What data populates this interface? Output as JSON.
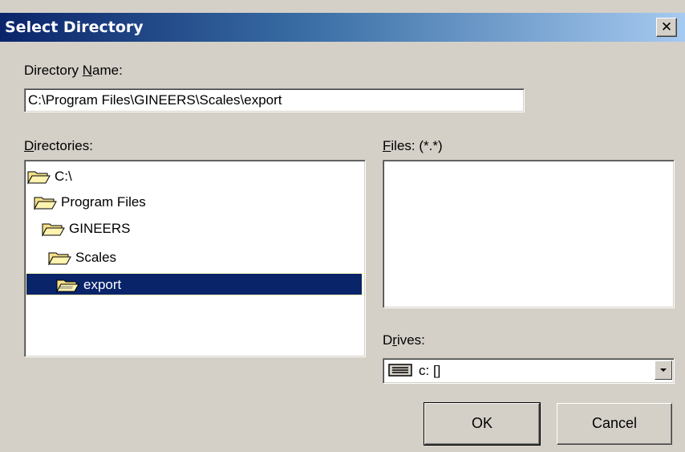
{
  "window": {
    "title": "Select Directory",
    "close_glyph": "✕"
  },
  "dirname": {
    "label_pre": "Directory ",
    "label_accel": "N",
    "label_post": "ame:",
    "value": "C:\\Program Files\\GINEERS\\Scales\\export"
  },
  "directories": {
    "label_accel": "D",
    "label_post": "irectories:",
    "items": [
      {
        "label": "C:\\",
        "icon": "open-folder-icon"
      },
      {
        "label": "Program Files",
        "icon": "open-folder-icon"
      },
      {
        "label": "GINEERS",
        "icon": "open-folder-icon"
      },
      {
        "label": "Scales",
        "icon": "open-folder-icon"
      },
      {
        "label": "export",
        "icon": "open-folder-selected-icon",
        "selected": true
      }
    ]
  },
  "files": {
    "label_accel": "F",
    "label_post": "iles: (*.*)"
  },
  "drives": {
    "label_pre": "D",
    "label_accel": "r",
    "label_post": "ives:",
    "selected": "c: []",
    "icon": "hard-drive-icon"
  },
  "buttons": {
    "ok": "OK",
    "cancel": "Cancel"
  },
  "colors": {
    "title_bar_start": "#0a246a",
    "selection": "#0a246a",
    "face": "#d4d0c8",
    "folder": "#f5e08a"
  }
}
